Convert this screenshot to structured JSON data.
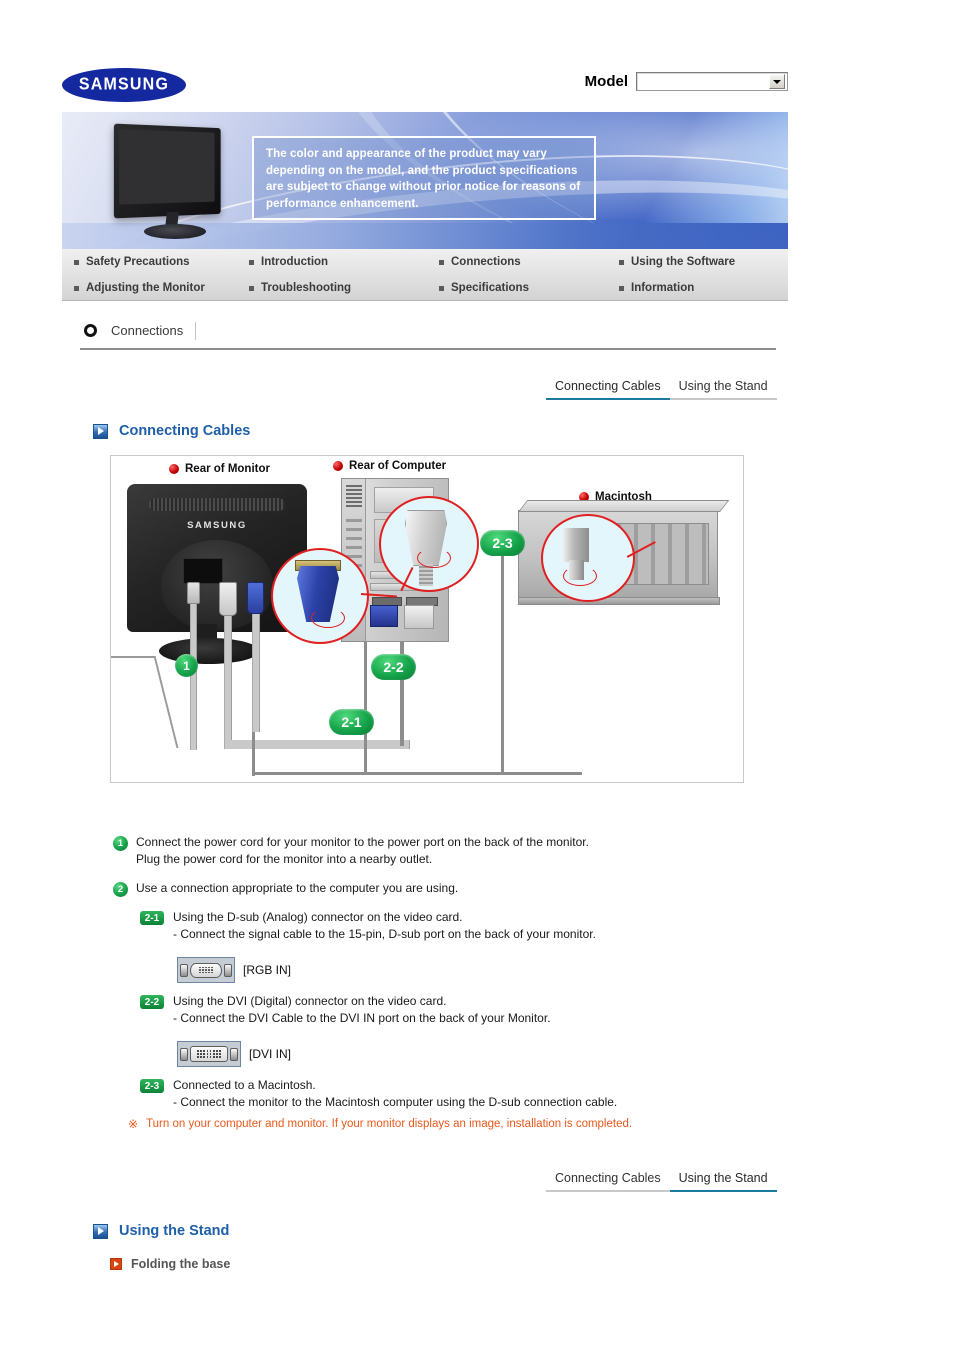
{
  "header": {
    "logo_text": "SAMSUNG",
    "model_label": "Model",
    "model_value": "",
    "model_arrow_icon": "chevron-down-icon"
  },
  "banner": {
    "notice_text": "The color and appearance of the product may vary depending on the model, and the product specifications are subject to change without prior notice for reasons of performance enhancement.",
    "monitor_illustration": "monitor-front-image"
  },
  "nav": {
    "items": [
      {
        "label": "Safety Precautions"
      },
      {
        "label": "Introduction"
      },
      {
        "label": "Connections"
      },
      {
        "label": "Using the Software"
      },
      {
        "label": "Adjusting the Monitor"
      },
      {
        "label": "Troubleshooting"
      },
      {
        "label": "Specifications"
      },
      {
        "label": "Information"
      }
    ]
  },
  "breadcrumb": {
    "icon": "ring-icon",
    "label": "Connections"
  },
  "tabs_top": [
    {
      "label": "Connecting Cables",
      "active": true
    },
    {
      "label": "Using the Stand",
      "active": false
    }
  ],
  "tabs_bottom": [
    {
      "label": "Connecting Cables",
      "active": false
    },
    {
      "label": "Using the Stand",
      "active": true
    }
  ],
  "sections": {
    "connecting_cables_title": "Connecting Cables",
    "using_the_stand_title": "Using the Stand",
    "folding_the_base_title": "Folding the base"
  },
  "diagram": {
    "label_monitor": "Rear of Monitor",
    "label_computer": "Rear of Computer",
    "label_macintosh": "Macintosh",
    "monitor_brand": "SAMSUNG",
    "badges": {
      "b1": "1",
      "b21": "2-1",
      "b22": "2-2",
      "b23": "2-3"
    }
  },
  "instructions": {
    "step1": {
      "number": "1",
      "line1": "Connect the power cord for your monitor to the power port on the back of the monitor.",
      "line2": "Plug the power cord for the monitor into a nearby outlet."
    },
    "step2": {
      "number": "2",
      "line1": "Use a connection appropriate to the computer you are using."
    },
    "step2_1": {
      "badge": "2-1",
      "line1": "Using the D-sub (Analog) connector on the video card.",
      "line2": "- Connect the signal cable to the 15-pin, D-sub port on the back of your monitor.",
      "port_caption": "[RGB IN]",
      "port_icon": "dsub-port-icon"
    },
    "step2_2": {
      "badge": "2-2",
      "line1": "Using the DVI (Digital) connector on the video card.",
      "line2": "- Connect the DVI Cable to the DVI IN port on the back of your Monitor.",
      "port_caption": "[DVI IN]",
      "port_icon": "dvi-port-icon"
    },
    "step2_3": {
      "badge": "2-3",
      "line1": "Connected to a Macintosh.",
      "line2": "- Connect the monitor to the Macintosh computer using the D-sub connection cable."
    },
    "note": {
      "mark": "※",
      "text": "Turn on your computer and monitor. If your monitor displays an image, installation is completed."
    }
  },
  "colors": {
    "brand_blue": "#1428a0",
    "heading_blue": "#1f5fa8",
    "tab_active": "#1b7a9e",
    "note_orange": "#e8591c",
    "badge_green": "#16a24b",
    "sub_icon_orange": "#d94512"
  }
}
